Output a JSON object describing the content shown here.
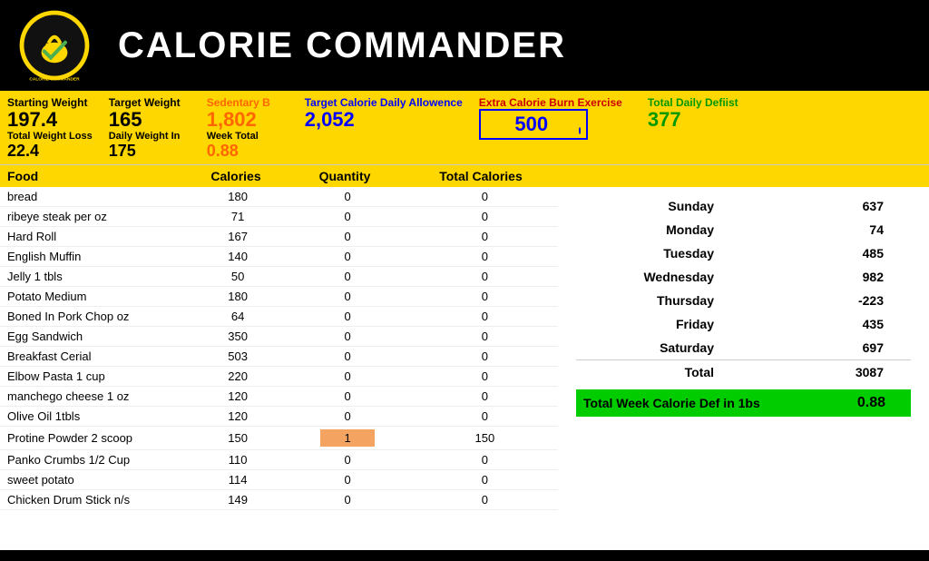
{
  "header": {
    "title": "CALORIE COMMANDER"
  },
  "stats": {
    "starting_weight_label": "Starting Weight",
    "starting_weight_value": "197.4",
    "target_weight_label": "Target Weight",
    "target_weight_value": "165",
    "sedentary_label": "Sedentary B",
    "sedentary_value": "1,802",
    "week_total_label": "Week Total",
    "week_total_value": "0.88",
    "target_calorie_label": "Target Calorie Daily Allowence",
    "target_calorie_value": "2,052",
    "total_weight_loss_label": "Total Weight Loss",
    "total_weight_loss_value": "22.4",
    "daily_weight_label": "Daily Weight In",
    "daily_weight_value": "175",
    "extra_burn_label": "Extra Calorie Burn Exercise",
    "extra_burn_value": "500",
    "total_daily_deficit_label": "Total Daily Defiist",
    "total_daily_deficit_value": "377"
  },
  "column_headers": {
    "food": "Food",
    "calories": "Calories",
    "quantity": "Quantity",
    "total_calories": "Total Calories"
  },
  "food_items": [
    {
      "name": "bread",
      "calories": 180,
      "quantity": 0,
      "total": 0
    },
    {
      "name": "ribeye steak per oz",
      "calories": 71,
      "quantity": 0,
      "total": 0
    },
    {
      "name": "Hard Roll",
      "calories": 167,
      "quantity": 0,
      "total": 0
    },
    {
      "name": "English Muffin",
      "calories": 140,
      "quantity": 0,
      "total": 0
    },
    {
      "name": "Jelly 1 tbls",
      "calories": 50,
      "quantity": 0,
      "total": 0
    },
    {
      "name": "Potato Medium",
      "calories": 180,
      "quantity": 0,
      "total": 0
    },
    {
      "name": "Boned In Pork Chop oz",
      "calories": 64,
      "quantity": 0,
      "total": 0
    },
    {
      "name": "Egg Sandwich",
      "calories": 350,
      "quantity": 0,
      "total": 0
    },
    {
      "name": "Breakfast Cerial",
      "calories": 503,
      "quantity": 0,
      "total": 0
    },
    {
      "name": "Elbow Pasta 1 cup",
      "calories": 220,
      "quantity": 0,
      "total": 0
    },
    {
      "name": "manchego cheese 1 oz",
      "calories": 120,
      "quantity": 0,
      "total": 0
    },
    {
      "name": "Olive Oil 1tbls",
      "calories": 120,
      "quantity": 0,
      "total": 0
    },
    {
      "name": "Protine Powder 2 scoop",
      "calories": 150,
      "quantity": 1,
      "total": 150,
      "highlight": true
    },
    {
      "name": "Panko Crumbs 1/2 Cup",
      "calories": 110,
      "quantity": 0,
      "total": 0
    },
    {
      "name": "sweet potato",
      "calories": 114,
      "quantity": 0,
      "total": 0
    },
    {
      "name": "Chicken Drum Stick n/s",
      "calories": 149,
      "quantity": 0,
      "total": 0
    }
  ],
  "weekly": {
    "days": [
      {
        "name": "Sunday",
        "value": 637
      },
      {
        "name": "Monday",
        "value": 74
      },
      {
        "name": "Tuesday",
        "value": 485
      },
      {
        "name": "Wednesday",
        "value": 982
      },
      {
        "name": "Thursday",
        "value": -223
      },
      {
        "name": "Friday",
        "value": 435
      },
      {
        "name": "Saturday",
        "value": 697
      }
    ],
    "total_label": "Total",
    "total_value": 3087,
    "week_def_label": "Total Week Calorie Def in 1bs",
    "week_def_value": "0.88"
  }
}
